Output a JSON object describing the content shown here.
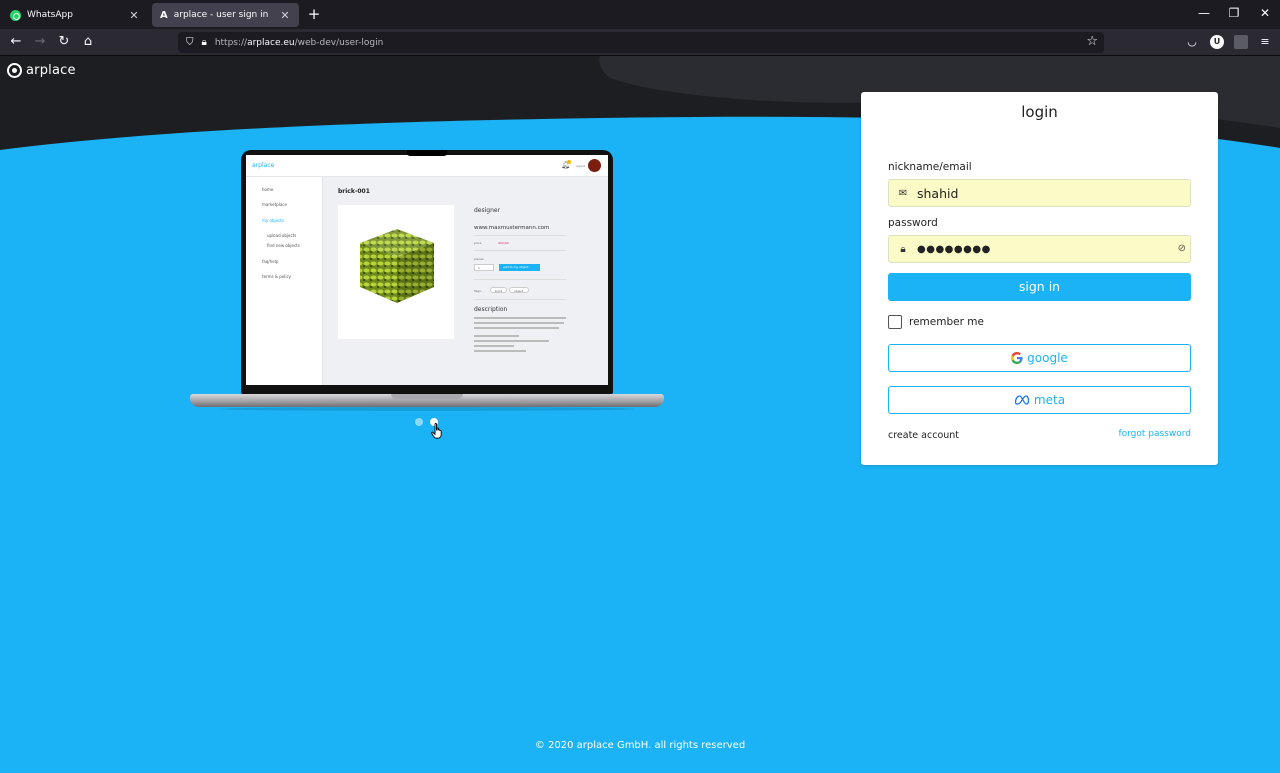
{
  "browser": {
    "tabs": [
      {
        "title": "WhatsApp",
        "icon": "whatsapp-icon",
        "active": false
      },
      {
        "title": "arplace - user sign in",
        "icon": "arplace-icon",
        "active": true
      }
    ],
    "url_prefix": "https://",
    "url_host": "arplace.eu",
    "url_path": "/web-dev/user-login"
  },
  "site": {
    "logo_text": "arplace",
    "accent_color": "#1bb3f5",
    "dark_color": "#1c1d20"
  },
  "mockup": {
    "app_logo": "arplace",
    "user": "Agent",
    "nav": [
      "home",
      "marketplace",
      "my objects",
      "upload objects",
      "find new objects",
      "faq/help",
      "terms & policy"
    ],
    "object_title": "brick-001",
    "designer_label": "designer",
    "website": "www.maxmustermann.com",
    "price_label": "price",
    "price": "400,00",
    "pieces_label": "pieces",
    "quantity": "1",
    "add_button": "add to my object",
    "tags_label": "Tags:",
    "tags": [
      "brick",
      "object"
    ],
    "description_label": "description"
  },
  "slider": {
    "dot_count": 2,
    "active_index": 1
  },
  "login": {
    "title": "login",
    "email_label": "nickname/email",
    "email_value": "shahid",
    "password_label": "password",
    "password_value": "●●●●●●●●",
    "signin_label": "sign in",
    "remember_label": "remember me",
    "remember_checked": false,
    "google_label": "google",
    "meta_label": "meta",
    "create_account_label": "create account",
    "forgot_label": "forgot password"
  },
  "footer": {
    "text": "© 2020 arplace GmbH. all rights reserved"
  }
}
